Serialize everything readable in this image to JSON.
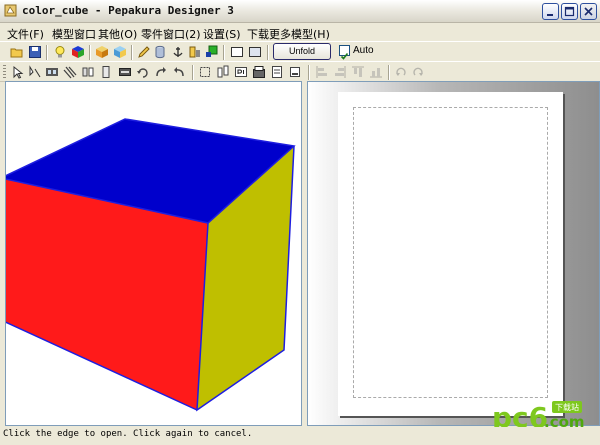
{
  "window": {
    "title": "color_cube - Pepakura Designer 3"
  },
  "menu": [
    "文件(F)",
    "模型窗口",
    "其他(O)",
    "零件窗口(2)",
    "设置(S)",
    "下载更多模型(H)"
  ],
  "toolbar": {
    "unfold_label": "Unfold",
    "auto_label": "Auto",
    "auto_checked": true
  },
  "model": {
    "faces": {
      "top": "#0000CC",
      "front": "#FF1A1A",
      "side": "#BFBF00"
    },
    "edge_color": "#1E1EE0"
  },
  "status": {
    "text": "Click the edge to open. Click again to cancel."
  },
  "watermark": {
    "text": "pc6",
    "sub": ".com"
  }
}
